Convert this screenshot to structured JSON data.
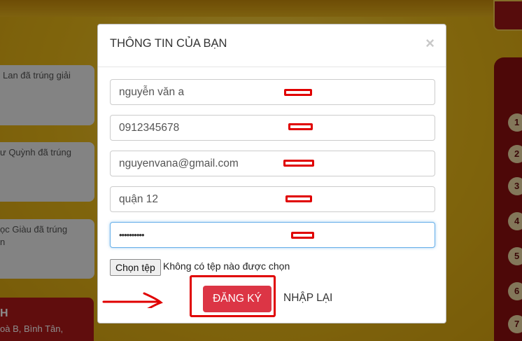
{
  "background": {
    "cards": [
      {
        "line1": "Lan đã trúng giải"
      },
      {
        "line1": "ư Quỳnh đã trúng"
      },
      {
        "line1": "ọc Giàu đã trúng",
        "line2": "n"
      }
    ],
    "red_box": {
      "title": "H",
      "address": "oà B, Bình Tân,"
    },
    "numbers": [
      "1",
      "2",
      "3",
      "4",
      "5",
      "6",
      "7"
    ]
  },
  "modal": {
    "title": "THÔNG TIN CỦA BẠN",
    "close_icon": "close-icon",
    "fields": {
      "name": "nguyễn văn a",
      "phone": "0912345678",
      "email": "nguyenvana@gmail.com",
      "district": "quận 12",
      "password_mask": "••••••••••"
    },
    "file": {
      "button_label": "Chọn tệp",
      "status": "Không có tệp nào được chọn"
    },
    "submit_label": "ĐĂNG KÝ",
    "reset_label": "NHẬP LẠI"
  },
  "colors": {
    "accent": "#dc3545",
    "annotation": "#e00000"
  }
}
